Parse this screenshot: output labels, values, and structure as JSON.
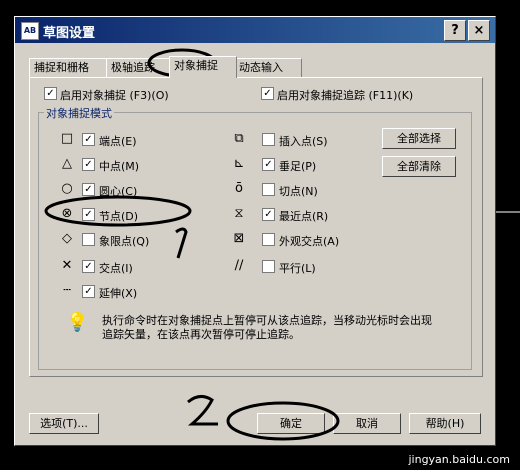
{
  "window": {
    "title": "草图设置",
    "app_icon": "AB",
    "help_button": "?",
    "close_button": "×"
  },
  "tabs": [
    "捕捉和栅格",
    "极轴追踪",
    "对象捕捉",
    "动态输入"
  ],
  "enable_snap": {
    "label": "启用对象捕捉 (F3)(O)",
    "checked": true
  },
  "enable_track": {
    "label": "启用对象捕捉追踪 (F11)(K)",
    "checked": true
  },
  "group_title": "对象捕捉模式",
  "modes_left": [
    {
      "icon": "square-icon",
      "label": "端点(E)",
      "checked": true
    },
    {
      "icon": "triangle-icon",
      "label": "中点(M)",
      "checked": true
    },
    {
      "icon": "circle-icon",
      "label": "圆心(C)",
      "checked": true
    },
    {
      "icon": "node-icon",
      "label": "节点(D)",
      "checked": true
    },
    {
      "icon": "diamond-icon",
      "label": "象限点(Q)",
      "checked": false
    },
    {
      "icon": "cross-icon",
      "label": "交点(I)",
      "checked": true
    },
    {
      "icon": "extension-icon",
      "label": "延伸(X)",
      "checked": true
    }
  ],
  "modes_right": [
    {
      "icon": "insert-icon",
      "label": "插入点(S)",
      "checked": false
    },
    {
      "icon": "perpendicular-icon",
      "label": "垂足(P)",
      "checked": true
    },
    {
      "icon": "tangent-icon",
      "label": "切点(N)",
      "checked": false
    },
    {
      "icon": "nearest-icon",
      "label": "最近点(R)",
      "checked": true
    },
    {
      "icon": "apparent-intersection-icon",
      "label": "外观交点(A)",
      "checked": false
    },
    {
      "icon": "parallel-icon",
      "label": "平行(L)",
      "checked": false
    }
  ],
  "select_all": "全部选择",
  "clear_all": "全部清除",
  "tip": "执行命令时在对象捕捉点上暂停可从该点追踪，当移动光标时会出现追踪矢量，在该点再次暂停可停止追踪。",
  "buttons": {
    "options": "选项(T)...",
    "ok": "确定",
    "cancel": "取消",
    "help": "帮助(H)"
  },
  "annotations": {
    "one": "1",
    "two": "2"
  },
  "watermark": "jingyan.baidu.com"
}
